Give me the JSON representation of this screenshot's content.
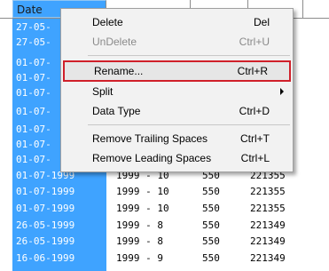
{
  "grid": {
    "headers": [
      "Date"
    ],
    "rows": [
      {
        "date": "27-05-",
        "ym": "",
        "n": "",
        "id": ""
      },
      {
        "date": "27-05-",
        "ym": "",
        "n": "",
        "id": ""
      },
      {
        "date": "01-07-",
        "ym": "",
        "n": "",
        "id": ""
      },
      {
        "date": "01-07-",
        "ym": "",
        "n": "",
        "id": ""
      },
      {
        "date": "01-07-",
        "ym": "",
        "n": "",
        "id": ""
      },
      {
        "date": "01-07-",
        "ym": "",
        "n": "",
        "id": ""
      },
      {
        "date": "01-07-",
        "ym": "",
        "n": "",
        "id": ""
      },
      {
        "date": "01-07-",
        "ym": "",
        "n": "",
        "id": ""
      },
      {
        "date": "01-07-",
        "ym": "",
        "n": "",
        "id": ""
      },
      {
        "date": "01-07-1999",
        "ym": "1999 - 10",
        "n": "550",
        "id": "221355"
      },
      {
        "date": "01-07-1999",
        "ym": "1999 - 10",
        "n": "550",
        "id": "221355"
      },
      {
        "date": "01-07-1999",
        "ym": "1999 - 10",
        "n": "550",
        "id": "221355"
      },
      {
        "date": "26-05-1999",
        "ym": "1999 - 8",
        "n": "550",
        "id": "221349"
      },
      {
        "date": "26-05-1999",
        "ym": "1999 - 8",
        "n": "550",
        "id": "221349"
      },
      {
        "date": "16-06-1999",
        "ym": "1999 - 9",
        "n": "550",
        "id": "221349"
      }
    ]
  },
  "context_menu": {
    "items": [
      {
        "label": "Delete",
        "shortcut": "Del"
      },
      {
        "label": "UnDelete",
        "shortcut": "Ctrl+U"
      },
      {
        "label": "Rename...",
        "shortcut": "Ctrl+R"
      },
      {
        "label": "Split",
        "shortcut": ""
      },
      {
        "label": "Data Type",
        "shortcut": "Ctrl+D"
      },
      {
        "label": "Remove Trailing Spaces",
        "shortcut": "Ctrl+T"
      },
      {
        "label": "Remove Leading Spaces",
        "shortcut": "Ctrl+L"
      }
    ],
    "disabled_item": "UnDelete",
    "highlighted_item": "Rename...",
    "highlight_color": "#d0202a"
  },
  "colors": {
    "selection": "#3fa3ff",
    "menu_background": "#f2f2f2"
  }
}
